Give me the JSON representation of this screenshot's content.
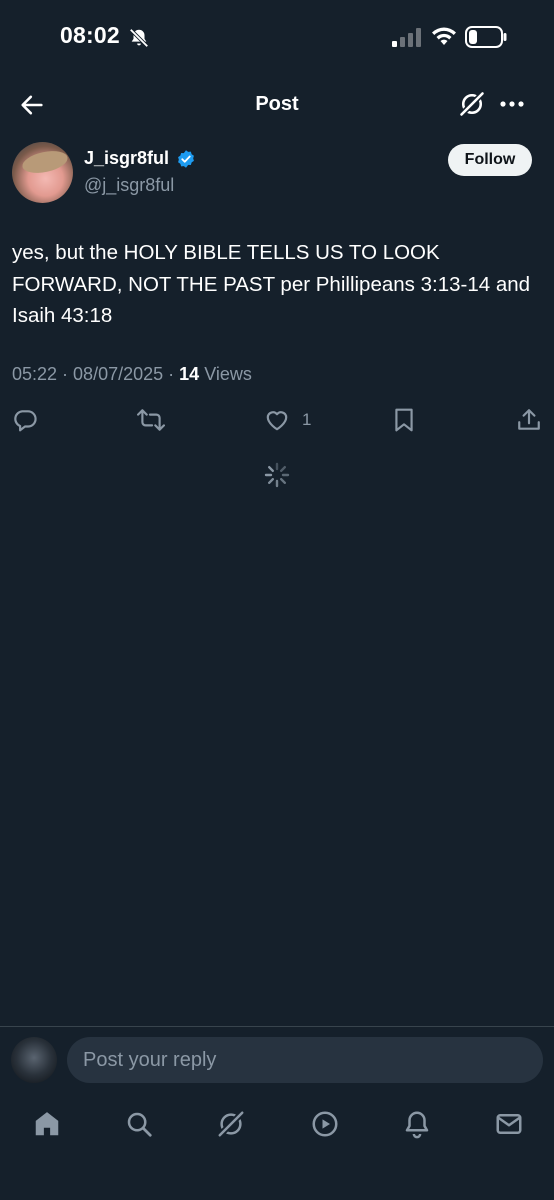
{
  "status_bar": {
    "time": "08:02"
  },
  "header": {
    "title": "Post"
  },
  "author": {
    "name": "J_isgr8ful",
    "handle": "@j_isgr8ful",
    "follow_label": "Follow"
  },
  "post": {
    "text": "yes, but the HOLY BIBLE TELLS US TO LOOK FORWARD, NOT THE PAST per Phillipeans 3:13-14 and Isaih 43:18",
    "time": "05:22",
    "date": "08/07/2025",
    "views_count": "14",
    "views_label": "Views"
  },
  "actions": {
    "like_count": "1"
  },
  "reply": {
    "placeholder": "Post your reply"
  },
  "icons": {
    "status": [
      "bell-mute-icon",
      "signal-icon",
      "wifi-icon",
      "battery-icon"
    ],
    "header": [
      "back-arrow-icon",
      "grok-icon",
      "more-icon"
    ],
    "actions": [
      "reply-icon",
      "repost-icon",
      "like-icon",
      "bookmark-icon",
      "share-icon"
    ],
    "nav": [
      "home-icon",
      "search-icon",
      "grok-icon",
      "video-icon",
      "notifications-icon",
      "messages-icon"
    ]
  },
  "colors": {
    "background": "#15202b",
    "muted": "#8b98a5",
    "verified": "#1d9bf0",
    "input": "#273340"
  }
}
